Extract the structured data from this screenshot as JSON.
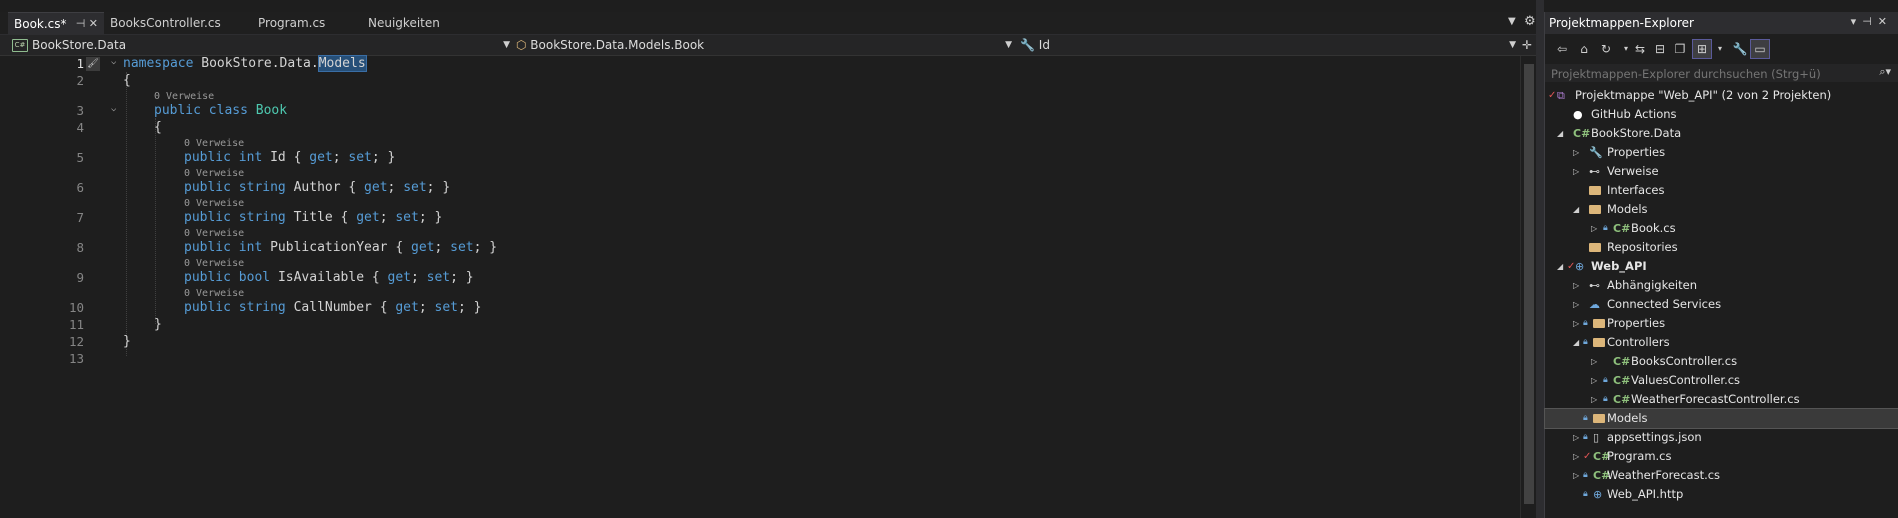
{
  "tabs": [
    {
      "label": "Book.cs*",
      "active": true
    },
    {
      "label": "BooksController.cs",
      "active": false
    },
    {
      "label": "Program.cs",
      "active": false
    },
    {
      "label": "Neuigkeiten",
      "active": false
    }
  ],
  "navbar": {
    "project": "BookStore.Data",
    "type": "BookStore.Data.Models.Book",
    "member": "Id"
  },
  "editor": {
    "line_numbers": [
      "1",
      "2",
      "3",
      "4",
      "5",
      "6",
      "7",
      "8",
      "9",
      "10",
      "11",
      "12",
      "13"
    ],
    "lens_label": "0 Verweise",
    "code": {
      "l1_kw": "namespace",
      "l1_ns": " BookStore.Data.",
      "l1_hl": "Models",
      "brace_open": "{",
      "brace_close": "}",
      "public": "public",
      "class": "class",
      "class_name": "Book",
      "int": "int",
      "string": "string",
      "bool": "bool",
      "get": "get",
      "set": "set",
      "props": [
        "Id",
        "Author",
        "Title",
        "PublicationYear",
        "IsAvailable",
        "CallNumber"
      ]
    }
  },
  "solution_explorer": {
    "title": "Projektmappen-Explorer",
    "search_placeholder": "Projektmappen-Explorer durchsuchen (Strg+ü)",
    "items": [
      {
        "label": "Projektmappe \"Web_API\" (2 von 2 Projekten)",
        "icon": "solution-icon"
      },
      {
        "label": "GitHub Actions",
        "icon": "github-icon"
      },
      {
        "label": "BookStore.Data",
        "icon": "csharp-project-icon"
      },
      {
        "label": "Properties",
        "icon": "wrench-icon"
      },
      {
        "label": "Verweise",
        "icon": "references-icon"
      },
      {
        "label": "Interfaces",
        "icon": "folder-icon"
      },
      {
        "label": "Models",
        "icon": "folder-icon"
      },
      {
        "label": "Book.cs",
        "icon": "csharp-file-icon"
      },
      {
        "label": "Repositories",
        "icon": "folder-icon"
      },
      {
        "label": "Web_API",
        "icon": "web-project-icon"
      },
      {
        "label": "Abhängigkeiten",
        "icon": "dependencies-icon"
      },
      {
        "label": "Connected Services",
        "icon": "connected-services-icon"
      },
      {
        "label": "Properties",
        "icon": "properties-icon"
      },
      {
        "label": "Controllers",
        "icon": "folder-icon"
      },
      {
        "label": "BooksController.cs",
        "icon": "csharp-file-icon"
      },
      {
        "label": "ValuesController.cs",
        "icon": "csharp-file-icon"
      },
      {
        "label": "WeatherForecastController.cs",
        "icon": "csharp-file-icon"
      },
      {
        "label": "Models",
        "icon": "folder-icon"
      },
      {
        "label": "appsettings.json",
        "icon": "json-file-icon"
      },
      {
        "label": "Program.cs",
        "icon": "csharp-file-icon"
      },
      {
        "label": "WeatherForecast.cs",
        "icon": "csharp-file-icon"
      },
      {
        "label": "Web_API.http",
        "icon": "http-file-icon"
      }
    ]
  },
  "colors": {
    "keyword": "#569cd6",
    "type": "#4ec9b0",
    "background": "#1e1e1e",
    "folder": "#dcb67a"
  }
}
